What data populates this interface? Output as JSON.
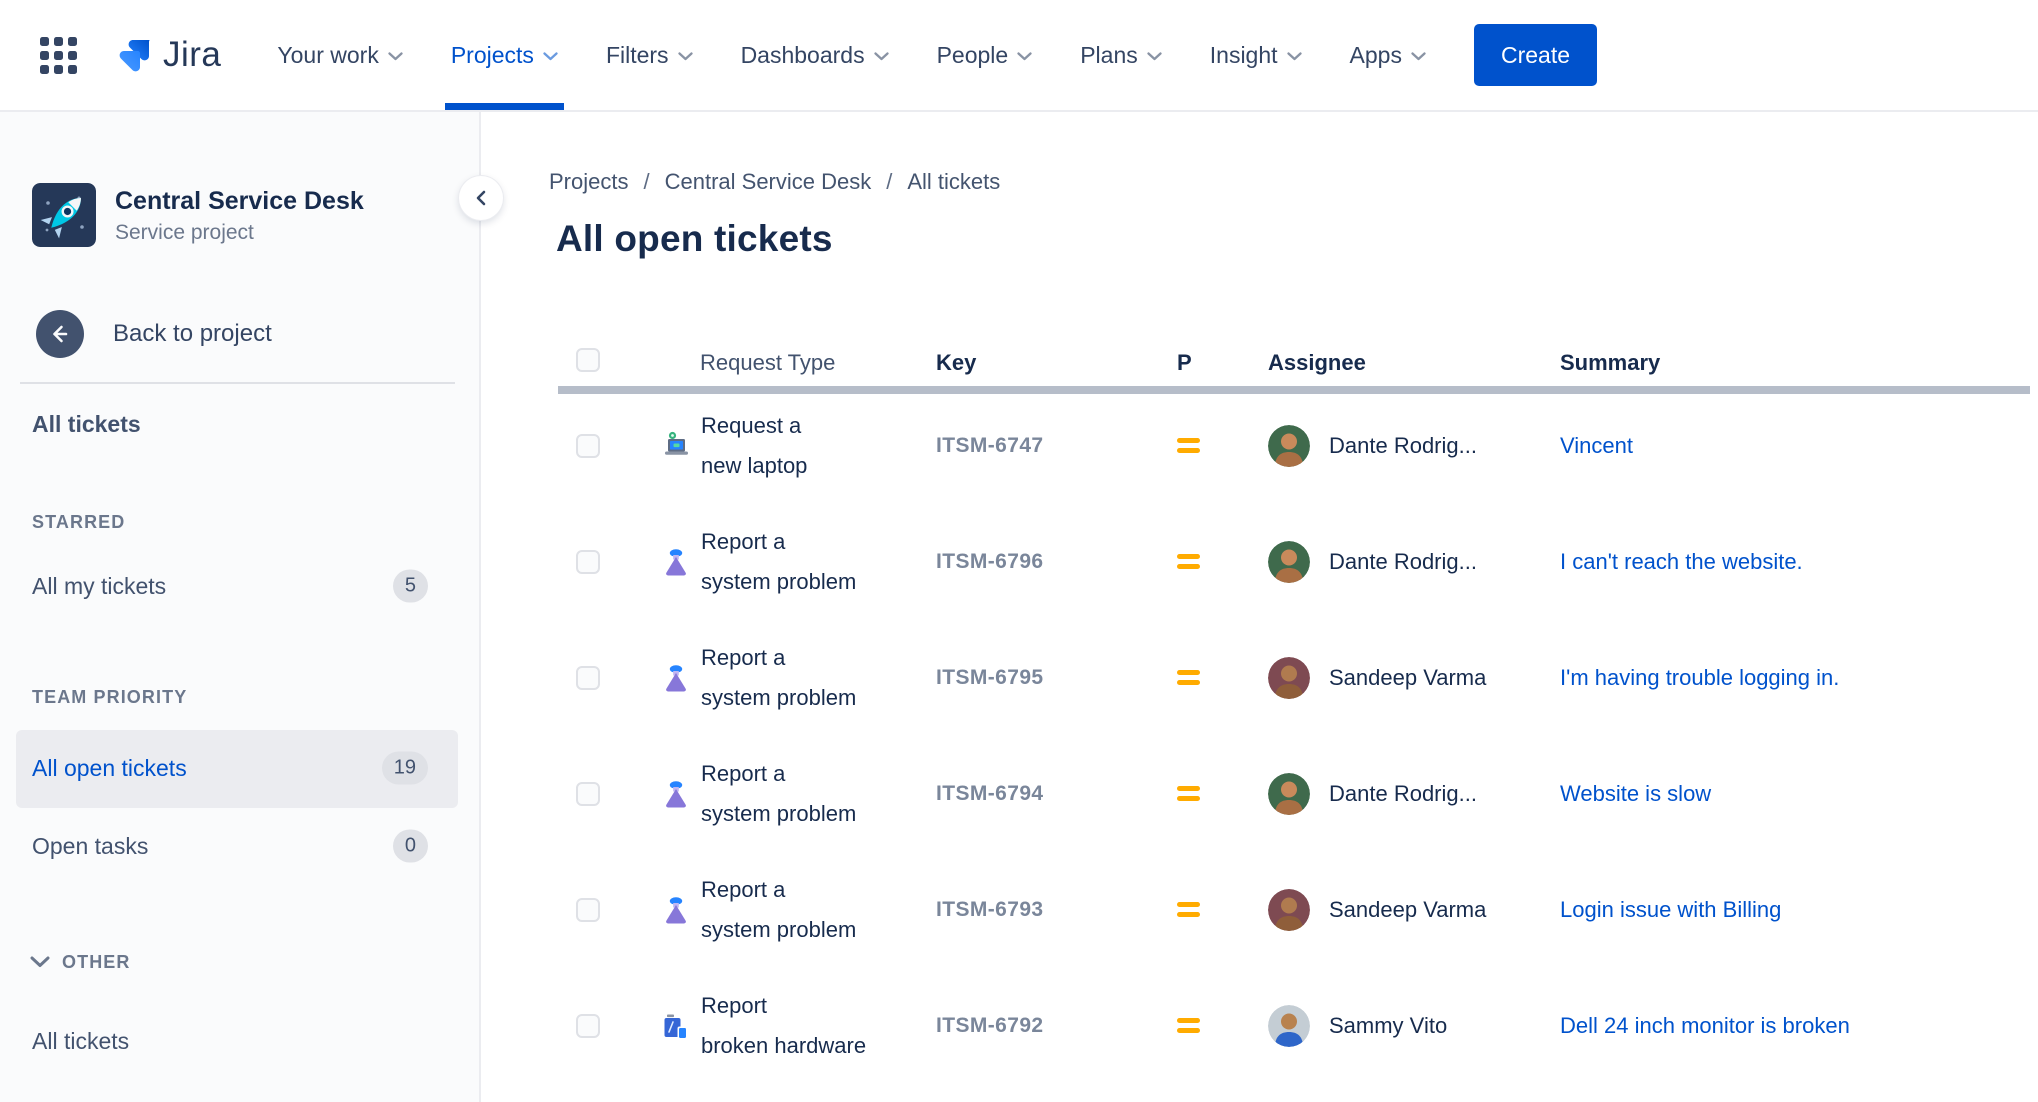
{
  "nav": {
    "logo_text": "Jira",
    "items": [
      {
        "label": "Your work"
      },
      {
        "label": "Projects",
        "active": true
      },
      {
        "label": "Filters"
      },
      {
        "label": "Dashboards"
      },
      {
        "label": "People"
      },
      {
        "label": "Plans"
      },
      {
        "label": "Insight"
      },
      {
        "label": "Apps"
      }
    ],
    "create_label": "Create"
  },
  "sidebar": {
    "project": {
      "name": "Central Service Desk",
      "type": "Service project",
      "icon": "rocket-project-icon"
    },
    "back_label": "Back to project",
    "top_item": "All tickets",
    "starred_heading": "STARRED",
    "starred_item": {
      "label": "All my tickets",
      "count": "5"
    },
    "team_heading": "TEAM PRIORITY",
    "team_items": [
      {
        "label": "All open tickets",
        "count": "19",
        "selected": true
      },
      {
        "label": "Open tasks",
        "count": "0"
      }
    ],
    "other_heading": "OTHER",
    "other_item": "All tickets"
  },
  "breadcrumb": {
    "items": [
      "Projects",
      "Central Service Desk",
      "All tickets"
    ],
    "separator": "/"
  },
  "page_title": "All open tickets",
  "table": {
    "headers": {
      "request_type": "Request Type",
      "key": "Key",
      "priority": "P",
      "assignee": "Assignee",
      "summary": "Summary"
    },
    "rows": [
      {
        "request_type": "Request a\nnew laptop",
        "request_icon": "laptop-icon",
        "key": "ITSM-6747",
        "priority": "medium",
        "priority_icon": "priority-medium-icon",
        "assignee": "Dante Rodrig...",
        "summary": "Vincent"
      },
      {
        "request_type": "Report a\nsystem problem",
        "request_icon": "system-problem-icon",
        "key": "ITSM-6796",
        "priority": "medium",
        "priority_icon": "priority-medium-icon",
        "assignee": "Dante Rodrig...",
        "summary": "I can't reach the website."
      },
      {
        "request_type": "Report a\nsystem problem",
        "request_icon": "system-problem-icon",
        "key": "ITSM-6795",
        "priority": "medium",
        "priority_icon": "priority-medium-icon",
        "assignee": "Sandeep Varma",
        "summary": "I'm having trouble logging in."
      },
      {
        "request_type": "Report a\nsystem problem",
        "request_icon": "system-problem-icon",
        "key": "ITSM-6794",
        "priority": "medium",
        "priority_icon": "priority-medium-icon",
        "assignee": "Dante Rodrig...",
        "summary": "Website is slow"
      },
      {
        "request_type": "Report a\nsystem problem",
        "request_icon": "system-problem-icon",
        "key": "ITSM-6793",
        "priority": "medium",
        "priority_icon": "priority-medium-icon",
        "assignee": "Sandeep Varma",
        "summary": "Login issue with Billing"
      },
      {
        "request_type": "Report\nbroken hardware",
        "request_icon": "broken-hardware-icon",
        "key": "ITSM-6792",
        "priority": "medium",
        "priority_icon": "priority-medium-icon",
        "assignee": "Sammy Vito",
        "summary": "Dell 24 inch monitor is broken"
      }
    ]
  },
  "colors": {
    "accent": "#0052CC",
    "link": "#0052CC",
    "priority_medium": "#FFAB00",
    "selected_item_bg": "#EBECF0",
    "sidebar_bg": "#FAFBFC"
  }
}
